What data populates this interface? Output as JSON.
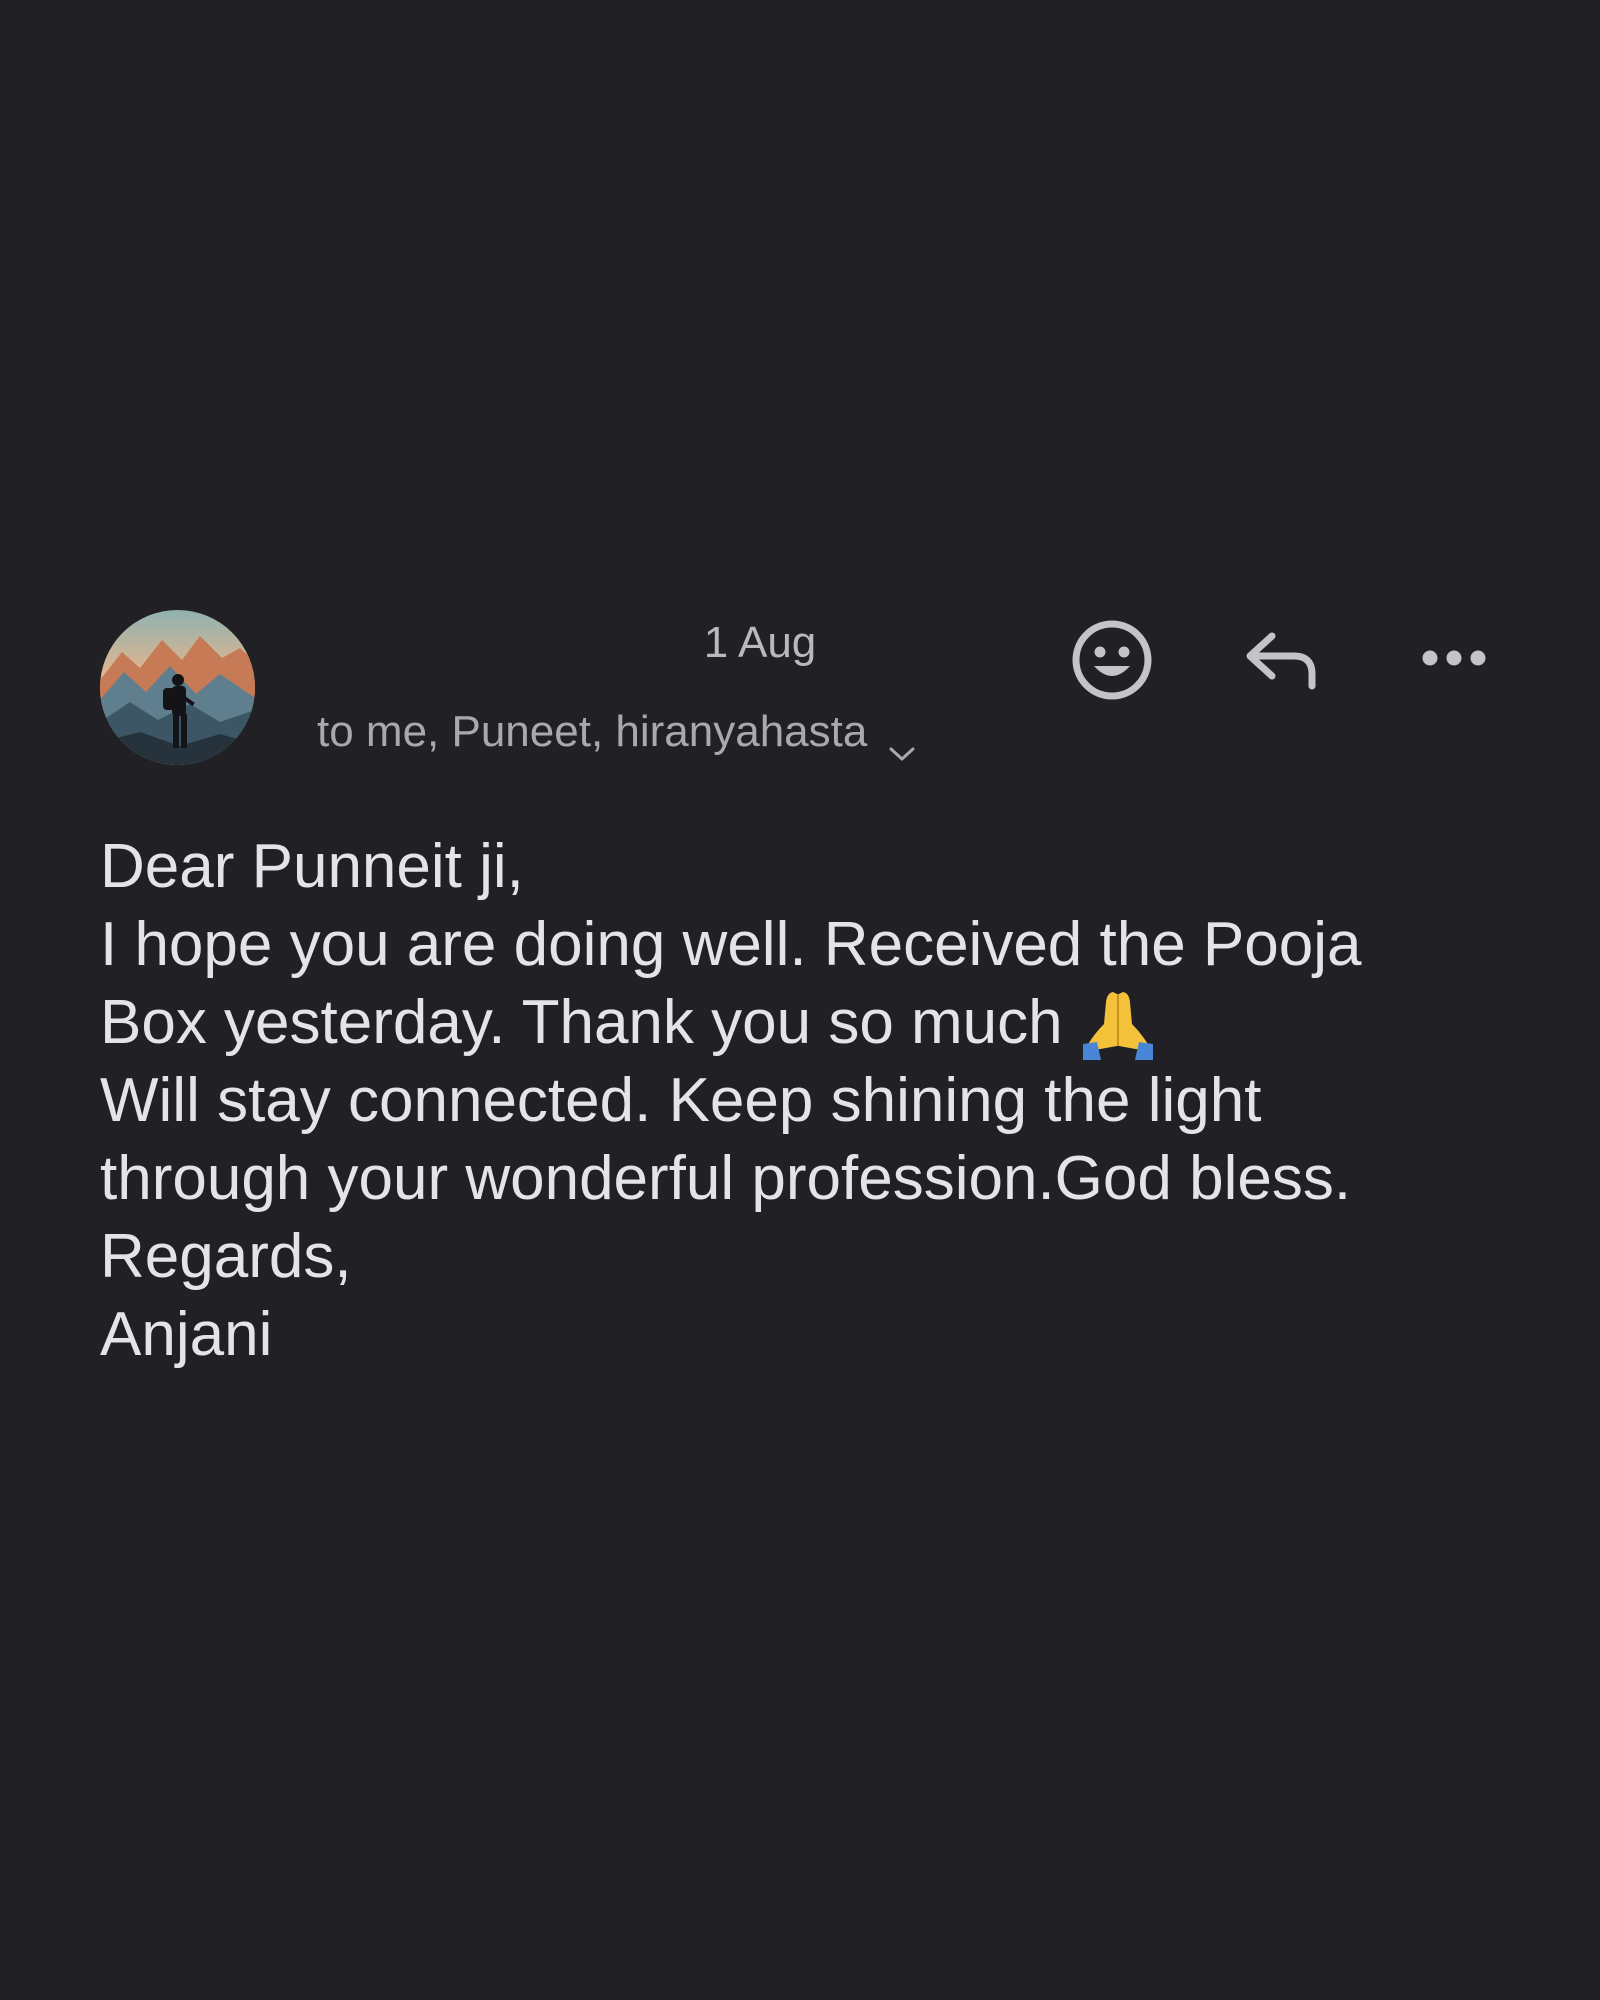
{
  "header": {
    "date": "1 Aug",
    "recipients": "to me, Puneet, hiranyahasta",
    "icons": {
      "avatar": "mountain-hiker-avatar",
      "emoji_reaction": "smiley-face-icon",
      "reply": "reply-arrow-icon",
      "more": "more-options-icon",
      "expand": "chevron-down-icon"
    }
  },
  "message": {
    "lines": [
      "Dear Punneit ji,",
      "I hope you are doing well. Received the Pooja",
      "Box yesterday. Thank you so much",
      "Will stay connected. Keep shining the light",
      "through your wonderful profession.God bless.",
      "Regards,",
      "Anjani"
    ],
    "emoji": "folded-hands-emoji"
  },
  "colors": {
    "background": "#202025",
    "text_primary": "#e4e4e6",
    "text_secondary": "#a9a9ad",
    "icon": "#c4c4c8"
  }
}
